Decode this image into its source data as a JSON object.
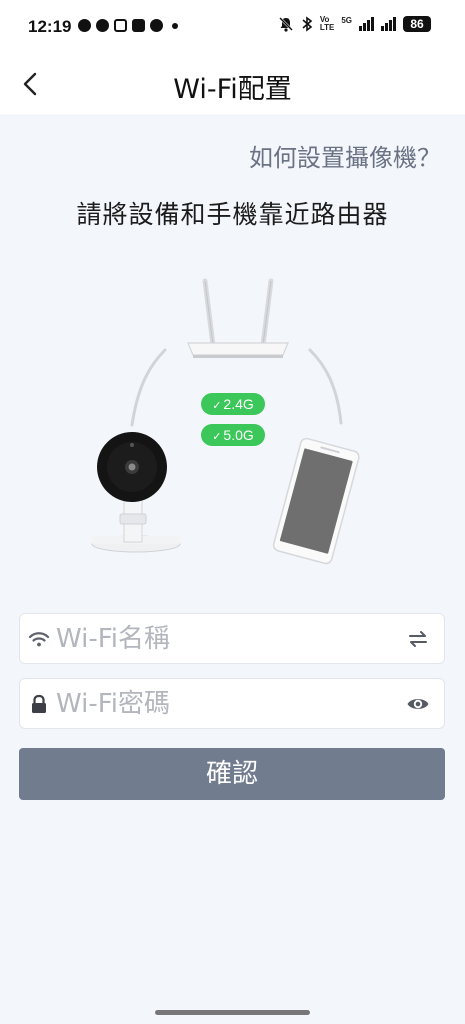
{
  "status_bar": {
    "time": "12:19",
    "network_label_top": "Vo",
    "network_label_bottom": "LTE",
    "signal_tech": "5G",
    "battery": "86"
  },
  "header": {
    "title": "Wi-Fi配置",
    "back_icon": "chevron-left-icon"
  },
  "help_link": "如何設置攝像機？",
  "instruction": "請將設備和手機靠近路由器",
  "illustration": {
    "badges": [
      {
        "label": "2.4G"
      },
      {
        "label": "5.0G"
      }
    ],
    "badge_color": "#3cc75a"
  },
  "form": {
    "wifi_name": {
      "value": "",
      "placeholder": "Wi-Fi名稱",
      "icon": "wifi-icon",
      "action_icon": "swap-icon"
    },
    "wifi_password": {
      "value": "",
      "placeholder": "Wi-Fi密碼",
      "icon": "lock-icon",
      "action_icon": "eye-icon"
    },
    "confirm_label": "確認",
    "confirm_color": "#727c8f"
  }
}
